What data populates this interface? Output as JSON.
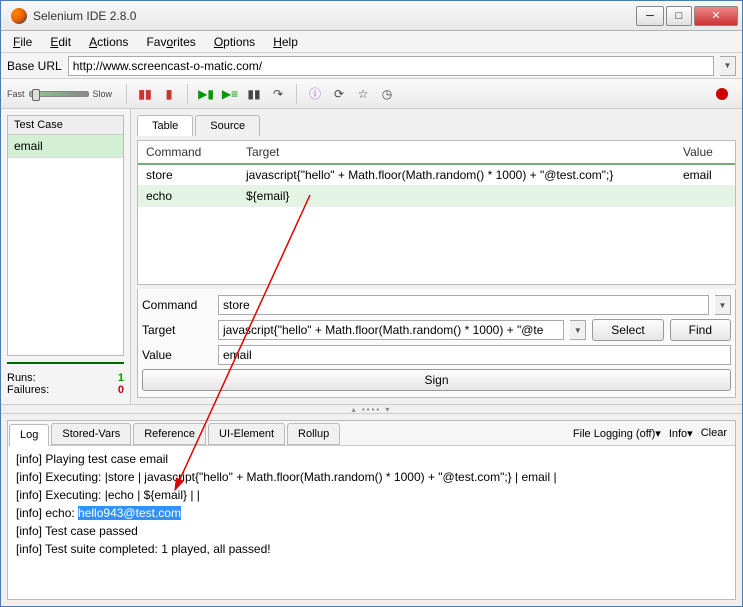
{
  "title": "Selenium IDE 2.8.0",
  "menus": [
    "File",
    "Edit",
    "Actions",
    "Favorites",
    "Options",
    "Help"
  ],
  "base_url_label": "Base URL",
  "base_url": "http://www.screencast-o-matic.com/",
  "speed": {
    "fast": "Fast",
    "slow": "Slow"
  },
  "testcase": {
    "header": "Test Case",
    "items": [
      "email"
    ]
  },
  "stats": {
    "runs_label": "Runs:",
    "runs": "1",
    "fails_label": "Failures:",
    "fails": "0"
  },
  "tabs": {
    "table": "Table",
    "source": "Source"
  },
  "grid": {
    "headers": {
      "command": "Command",
      "target": "Target",
      "value": "Value"
    },
    "rows": [
      {
        "command": "store",
        "target": "javascript{\"hello\" + Math.floor(Math.random() * 1000) + \"@test.com\";}",
        "value": "email"
      },
      {
        "command": "echo",
        "target": "${email}",
        "value": ""
      }
    ]
  },
  "form": {
    "command_label": "Command",
    "command_value": "store",
    "target_label": "Target",
    "target_value": "javascript{\"hello\" + Math.floor(Math.random() * 1000) + \"@te",
    "value_label": "Value",
    "value_value": "email",
    "select": "Select",
    "find": "Find",
    "sign": "Sign"
  },
  "logtabs": [
    "Log",
    "Stored-Vars",
    "Reference",
    "UI-Element",
    "Rollup"
  ],
  "log_toolbar": {
    "filelog": "File Logging (off)",
    "info": "Info",
    "clear": "Clear"
  },
  "log": {
    "lines": [
      "[info] Playing test case email",
      "[info] Executing: |store | javascript{\"hello\" + Math.floor(Math.random() * 1000) + \"@test.com\";} | email |",
      "[info] Executing: |echo | ${email} | |",
      "[info] echo: ",
      "[info] Test case passed",
      "[info] Test suite completed: 1 played, all passed!"
    ],
    "highlight": "hello943@test.com"
  }
}
